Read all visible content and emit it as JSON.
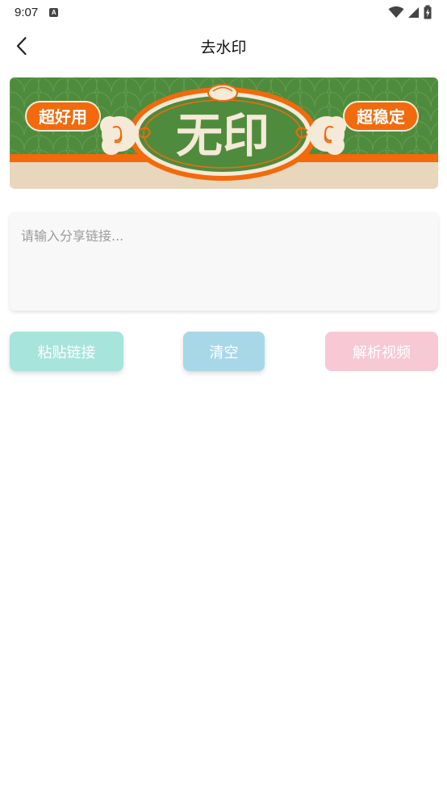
{
  "status_bar": {
    "time": "9:07",
    "notification_icon": "A"
  },
  "header": {
    "title": "去水印",
    "back_icon": "chevron-left-icon"
  },
  "banner": {
    "left_tag": "超好用",
    "center_text": "无印",
    "right_tag": "超稳定",
    "colors": {
      "green": "#4f8b3d",
      "orange": "#f26a0c",
      "beige": "#e8d6bd",
      "cream": "#f4ead7"
    }
  },
  "input": {
    "placeholder": "请输入分享链接...",
    "value": ""
  },
  "buttons": {
    "paste": "粘贴链接",
    "clear": "清空",
    "parse": "解析视频"
  },
  "colors": {
    "paste_button": "#a6e4dc",
    "clear_button": "#a8d8e8",
    "parse_button": "#f7c9d4"
  }
}
